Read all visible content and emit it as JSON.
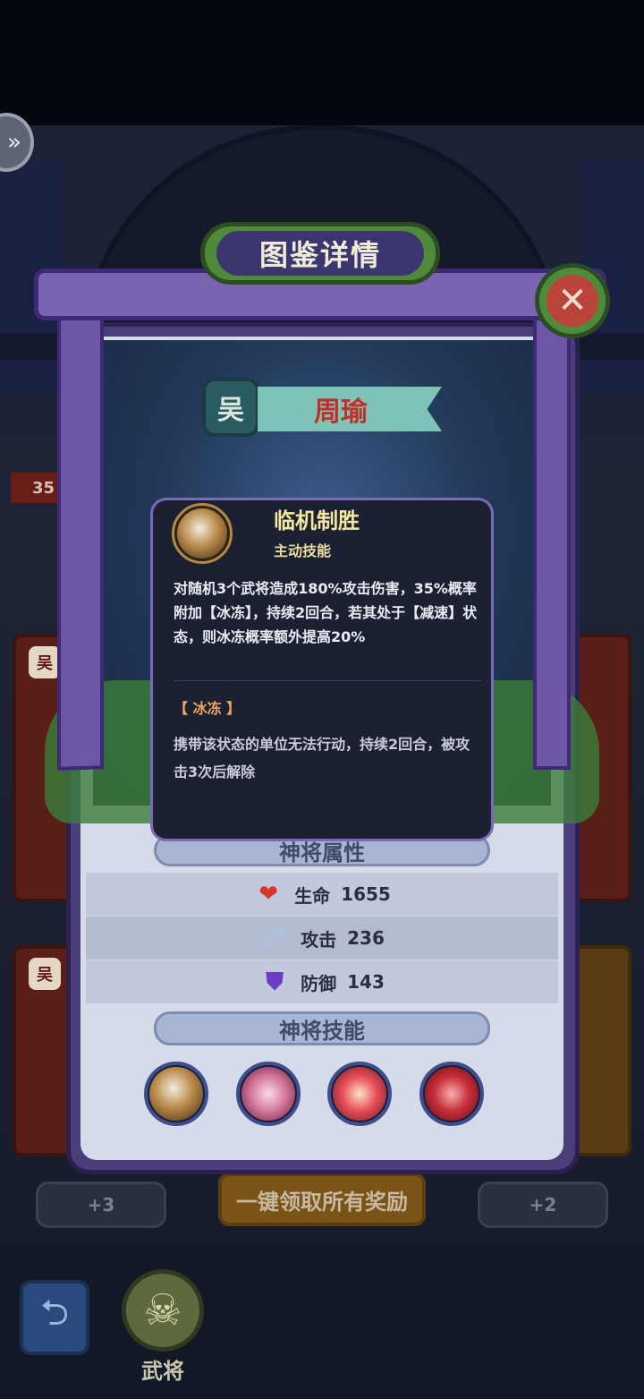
{
  "panel": {
    "title": "图鉴详情",
    "close_icon": "close-x-icon"
  },
  "hero": {
    "faction": "吴",
    "name": "周瑜"
  },
  "skill_tooltip": {
    "name": "临机制胜",
    "type": "主动技能",
    "description": "对随机3个武将造成180%攻击伤害，35%概率附加【冰冻】，持续2回合，若其处于【减速】状态，则冰冻概率额外提高20%",
    "status_name": "【 冰冻 】",
    "status_description": "携带该状态的单位无法行动，持续2回合，被攻击3次后解除"
  },
  "attributes": {
    "header": "神将属性",
    "stats": [
      {
        "label": "生命",
        "value": "1655",
        "icon": "heart-icon"
      },
      {
        "label": "攻击",
        "value": "236",
        "icon": "sword-icon"
      },
      {
        "label": "防御",
        "value": "143",
        "icon": "shield-icon"
      }
    ]
  },
  "skills": {
    "header": "神将技能",
    "items": [
      {
        "icon": "mask-skill-icon",
        "color": "#b88a4a"
      },
      {
        "icon": "blossom-skill-icon",
        "color": "#d87aa0"
      },
      {
        "icon": "lotus-skill-icon",
        "color": "#e8505a"
      },
      {
        "icon": "rose-skill-icon",
        "color": "#c8303a"
      }
    ]
  },
  "background": {
    "side_faction_1": "吴",
    "side_faction_2": "吴",
    "level_badge": "35",
    "reward_left": "+3",
    "reward_right": "+2",
    "claim_all_label": "一键领取所有奖励"
  },
  "bottom_nav": {
    "back_icon": "back-arrow-icon",
    "general_label": "武将"
  },
  "colors": {
    "tooltip_title": "#f6e7a0",
    "status_highlight": "#f1a55a",
    "hero_name": "#c0302a",
    "panel_border": "#4a3d7a"
  }
}
